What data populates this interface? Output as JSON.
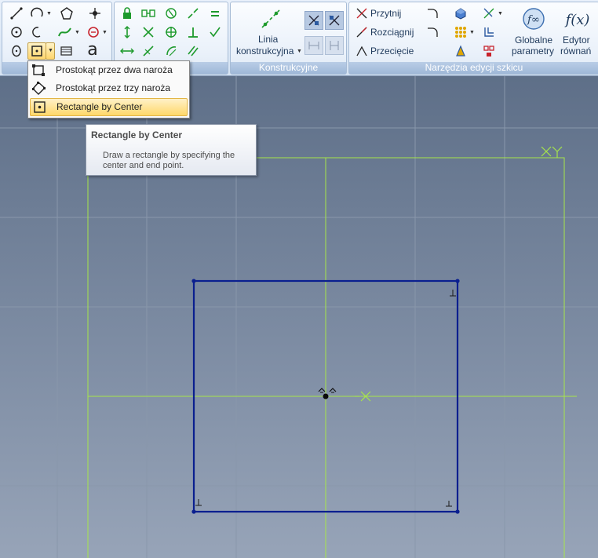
{
  "ribbon": {
    "groups": {
      "rysuj": {
        "label": ""
      },
      "ograniczenia": {
        "label": ""
      },
      "konstrukcyjne": {
        "label": "Konstrukcyjne",
        "construction_line_label": "Linia",
        "construction_line_label2": "konstrukcyjna"
      },
      "narzedzia": {
        "label": "Narzędzia edycji szkicu",
        "trim": "Przytnij",
        "extend": "Rozciągnij",
        "intersection": "Przecięcie",
        "global_params_label1": "Globalne",
        "global_params_label2": "parametry",
        "equation_editor_label1": "Edytor",
        "equation_editor_label2": "równań",
        "equation_editor_symbol": "f(x)",
        "global_params_symbol": "f∞"
      }
    },
    "text_tool_glyph": "a"
  },
  "rectangle_menu": {
    "items": [
      {
        "label": "Prostokąt przez dwa naroża",
        "icon": "rectangle-two-corners-icon"
      },
      {
        "label": "Prostokąt przez trzy naroża",
        "icon": "rectangle-three-corners-icon"
      },
      {
        "label": "Rectangle by Center",
        "icon": "rectangle-center-icon",
        "highlighted": true
      }
    ]
  },
  "tooltip": {
    "title": "Rectangle by Center",
    "description": "Draw a rectangle by specifying the center and end point."
  },
  "canvas": {
    "background_top": "#5e6f88",
    "background_bottom": "#97a4b8",
    "axis_color": "#a7e64a",
    "sketch_color": "#0a1f8f",
    "axis_label": "XY"
  }
}
